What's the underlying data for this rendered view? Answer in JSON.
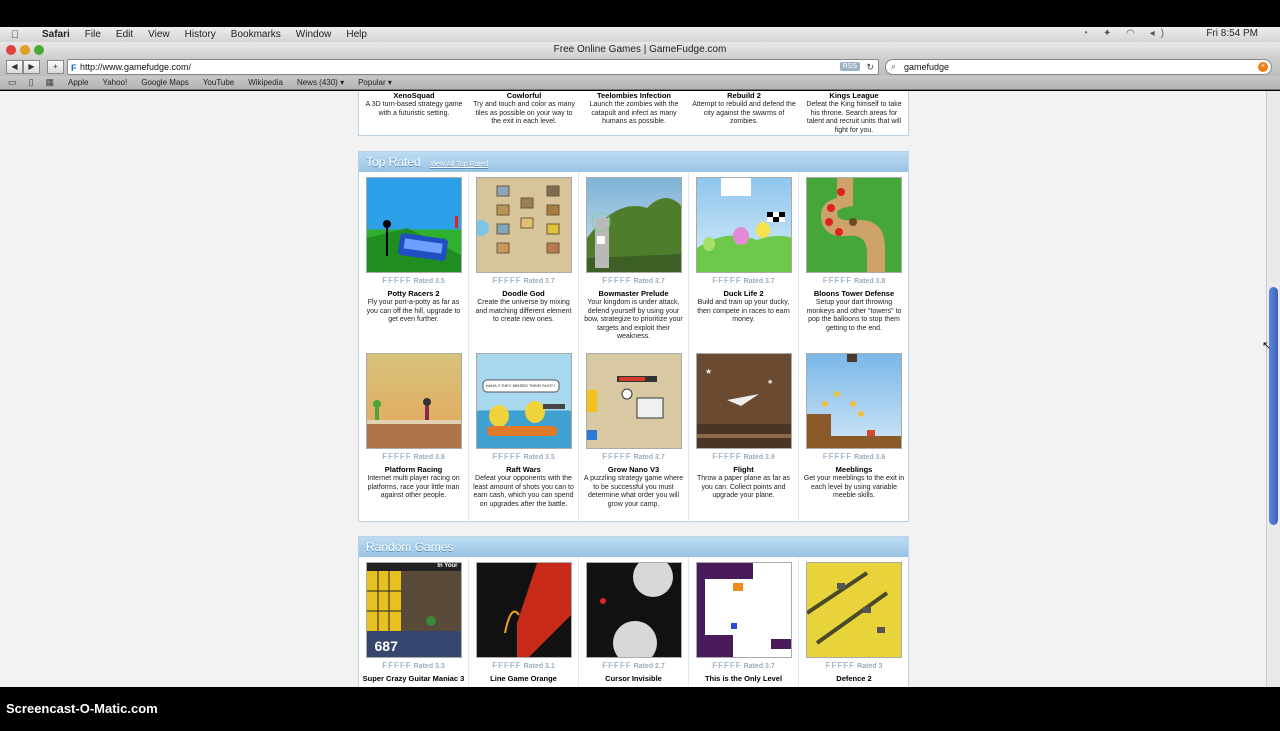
{
  "menubar": {
    "app": "Safari",
    "items": [
      "File",
      "Edit",
      "View",
      "History",
      "Bookmarks",
      "Window",
      "Help"
    ],
    "clock": "Fri 8:54 PM"
  },
  "window": {
    "title": "Free Online Games | GameFudge.com"
  },
  "toolbar": {
    "url": "http://www.gamefudge.com/",
    "rss": "RSS",
    "search": "gamefudge",
    "add": "+"
  },
  "bookmarks": [
    "Apple",
    "Yahoo!",
    "Google Maps",
    "YouTube",
    "Wikipedia",
    "News (430) ▾",
    "Popular ▾"
  ],
  "prev_row": [
    {
      "name": "XenoSquad",
      "desc": "A 3D turn-based strategy game with a futuristic setting."
    },
    {
      "name": "Cowlorful",
      "desc": "Try and touch and color as many tiles as possible on your way to the exit in each level."
    },
    {
      "name": "Teelombies Infection",
      "desc": "Launch the zombies with the catapult and infect as many humans as possible."
    },
    {
      "name": "Rebuild 2",
      "desc": "Attempt to rebuild and defend the city against the swarms of zombies."
    },
    {
      "name": "Kings League",
      "desc": "Defeat the King himself to take his throne. Search areas for talent and recruit units that will fight for you."
    }
  ],
  "top_rated": {
    "title": "Top Rated",
    "link": "View All Top Rated",
    "games": [
      {
        "name": "Potty Racers 2",
        "rating": "Rated 3.5",
        "desc": "Fly your port-a-potty as far as you can off the hill, upgrade to get even further."
      },
      {
        "name": "Doodle God",
        "rating": "Rated 3.7",
        "desc": "Create the universe by mixing and matching different element to create new ones."
      },
      {
        "name": "Bowmaster Prelude",
        "rating": "Rated 3.7",
        "desc": "Your kingdom is under attack, defend yourself by using your bow, strategize to prioritize your targets and exploit their weakness."
      },
      {
        "name": "Duck Life 2",
        "rating": "Rated 3.7",
        "desc": "Build and train up your ducky, then compete in races to earn money."
      },
      {
        "name": "Bloons Tower Defense",
        "rating": "Rated 3.8",
        "desc": "Setup your dart throwing monkeys and other \"towers\" to pop the balloons to stop them getting to the end."
      },
      {
        "name": "Platform Racing",
        "rating": "Rated 3.9",
        "desc": "Internet multi player racing on platforms, race your little man against other people."
      },
      {
        "name": "Raft Wars",
        "rating": "Rated 3.5",
        "desc": "Defeat your opponents with the least amount of shots you can to earn cash, which you can spend on upgrades after the battle."
      },
      {
        "name": "Grow Nano V3",
        "rating": "Rated 3.7",
        "desc": "A puzzling strategy game where to be successful you must determine what order you will grow your camp."
      },
      {
        "name": "Flight",
        "rating": "Rated 3.9",
        "desc": "Throw a paper plane as far as you can. Collect points and upgrade your plane."
      },
      {
        "name": "Meeblings",
        "rating": "Rated 3.6",
        "desc": "Get your meeblings to the exit in each level by using variable meeble skills."
      }
    ]
  },
  "random_games": {
    "title": "Random Games",
    "games": [
      {
        "name": "Super Crazy Guitar Maniac 3",
        "rating": "Rated 3.3",
        "score": "687",
        "header": "In Your"
      },
      {
        "name": "Line Game Orange",
        "rating": "Rated 3.1"
      },
      {
        "name": "Cursor Invisible",
        "rating": "Rated 2.7"
      },
      {
        "name": "This is the Only Level",
        "rating": "Rated 3.7"
      },
      {
        "name": "Defence 2",
        "rating": "Rated 3"
      }
    ]
  },
  "stars": "FFFFF",
  "raft_bubble": "HAHA !! THEY MISSED THEIR SHOT !",
  "caption": "Screencast-O-Matic.com"
}
